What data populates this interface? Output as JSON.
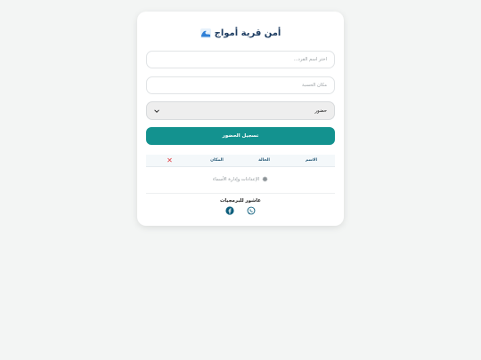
{
  "header": {
    "title": "أمن قرية أمواج",
    "icon": "wave-icon"
  },
  "form": {
    "name_placeholder": "اختر اسم الفرد...",
    "location_placeholder": "مكان الحسبة",
    "status_value": "حضور",
    "submit_label": "تسجيل الحضور"
  },
  "table": {
    "headers": [
      "الاسم",
      "الحالة",
      "المكان"
    ],
    "delete_symbol": "✕"
  },
  "settings": {
    "label": "الإعدادات وإدارة الأسماء"
  },
  "footer": {
    "name": "عاشور للبرمجيات"
  },
  "colors": {
    "accent": "#13928f",
    "title": "#1f3e63",
    "delete": "#e0383e"
  }
}
